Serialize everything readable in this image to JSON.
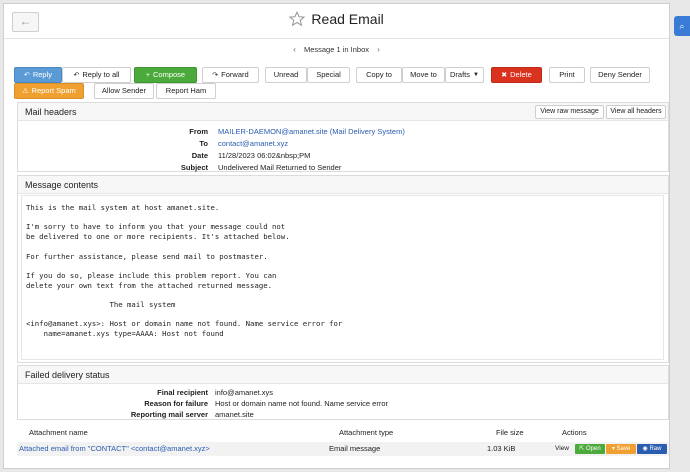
{
  "window": {
    "title": "Read Email",
    "back_label": "←"
  },
  "pager": {
    "label": "Message 1 in Inbox",
    "prev": "‹",
    "next": "›"
  },
  "toolbar": {
    "reply": "Reply",
    "reply_all": "Reply to all",
    "compose": "Compose",
    "forward": "Forward",
    "unread": "Unread",
    "special": "Special",
    "copy_to": "Copy to",
    "move_to": "Move to",
    "folder_select": "Drafts",
    "delete": "Delete",
    "print": "Print",
    "deny_sender": "Deny Sender",
    "report_spam": "Report Spam",
    "allow_sender": "Allow Sender",
    "report_ham": "Report Ham"
  },
  "mail_headers": {
    "heading": "Mail headers",
    "view_raw": "View raw message",
    "view_all": "View all headers",
    "rows": [
      {
        "key": "From",
        "value": "MAILER-DAEMON@amanet.site (Mail Delivery System)"
      },
      {
        "key": "To",
        "value": "contact@amanet.xyz"
      },
      {
        "key": "Date",
        "value": "11/28/2023 06:02&nbsp;PM"
      },
      {
        "key": "Subject",
        "value": "Undelivered Mail Returned to Sender"
      }
    ]
  },
  "contents": {
    "heading": "Message contents",
    "body": "This is the mail system at host amanet.site.\n\nI'm sorry to have to inform you that your message could not\nbe delivered to one or more recipients. It's attached below.\n\nFor further assistance, please send mail to postmaster.\n\nIf you do so, please include this problem report. You can\ndelete your own text from the attached returned message.\n\n                   The mail system\n\n<info@amanet.xys>: Host or domain name not found. Name service error for\n    name=amanet.xys type=AAAA: Host not found"
  },
  "failed": {
    "heading": "Failed delivery status",
    "rows": [
      {
        "key": "Final recipient",
        "value": "info@amanet.xys"
      },
      {
        "key": "Reason for failure",
        "value": "Host or domain name not found. Name service error"
      },
      {
        "key": "Reporting mail server",
        "value": "amanet.site"
      }
    ]
  },
  "attachments": {
    "headers": {
      "name": "Attachment name",
      "type": "Attachment type",
      "size": "File size",
      "actions": "Actions"
    },
    "row": {
      "name": "Attached email from \"CONTACT\" <contact@amanet.xyz>",
      "type": "Email message",
      "size": "1.03 KiB",
      "view": "View",
      "open": "Open",
      "save": "Save",
      "raw": "Raw"
    }
  },
  "colors": {
    "accent_blue": "#5b9bd5",
    "compose_green": "#4caa3c",
    "delete_red": "#d9321f",
    "spam_orange": "#f0a030",
    "link": "#2a5db0"
  }
}
